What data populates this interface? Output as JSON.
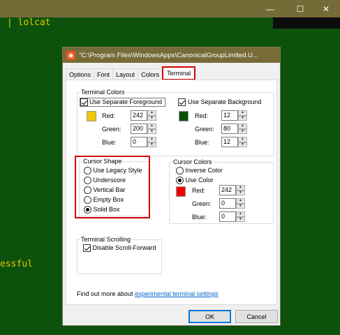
{
  "terminal": {
    "line1": "| lolcat",
    "line2": "essful"
  },
  "window_buttons": {
    "minimize": "—",
    "maximize": "☐",
    "close": "✕"
  },
  "dialog": {
    "title": "\"C:\\Program Files\\WindowsApps\\CanonicalGroupLimited.U...",
    "icon_glyph": "◉",
    "tabs": [
      {
        "label": "Options"
      },
      {
        "label": "Font"
      },
      {
        "label": "Layout"
      },
      {
        "label": "Colors"
      },
      {
        "label": "Terminal",
        "active": true
      }
    ],
    "terminal_colors": {
      "group_label": "Terminal Colors",
      "foreground": {
        "checkbox_label": "Use Separate Foreground",
        "checked": true,
        "swatch_color": "#f2c800",
        "red_label": "Red:",
        "red": "242",
        "green_label": "Green:",
        "green": "200",
        "blue_label": "Blue:",
        "blue": "0"
      },
      "background": {
        "checkbox_label": "Use Separate Background",
        "checked": true,
        "swatch_color": "#0c500c",
        "red_label": "Red:",
        "red": "12",
        "green_label": "Green:",
        "green": "80",
        "blue_label": "Blue:",
        "blue": "12"
      }
    },
    "cursor_shape": {
      "group_label": "Cursor Shape",
      "options": [
        {
          "label": "Use Legacy Style",
          "selected": false
        },
        {
          "label": "Underscore",
          "selected": false
        },
        {
          "label": "Vertical Bar",
          "selected": false
        },
        {
          "label": "Empty Box",
          "selected": false
        },
        {
          "label": "Solid Box",
          "selected": true
        }
      ]
    },
    "cursor_colors": {
      "group_label": "Cursor Colors",
      "inverse_label": "Inverse Color",
      "use_color_label": "Use Color",
      "selected": "use_color",
      "swatch_color": "#f20000",
      "red_label": "Red:",
      "red": "242",
      "green_label": "Green:",
      "green": "0",
      "blue_label": "Blue:",
      "blue": "0"
    },
    "terminal_scrolling": {
      "group_label": "Terminal Scrolling",
      "checkbox_label": "Disable Scroll-Forward",
      "checked": true
    },
    "footer": {
      "text": "Find out more about",
      "link": "experimental terminal settings"
    },
    "buttons": {
      "ok": "OK",
      "cancel": "Cancel"
    }
  },
  "colors": {
    "highlight": "#d40000",
    "terminal_bg": "#0c520c",
    "terminal_fg": "#e6c500",
    "titlebar": "#776b38"
  }
}
